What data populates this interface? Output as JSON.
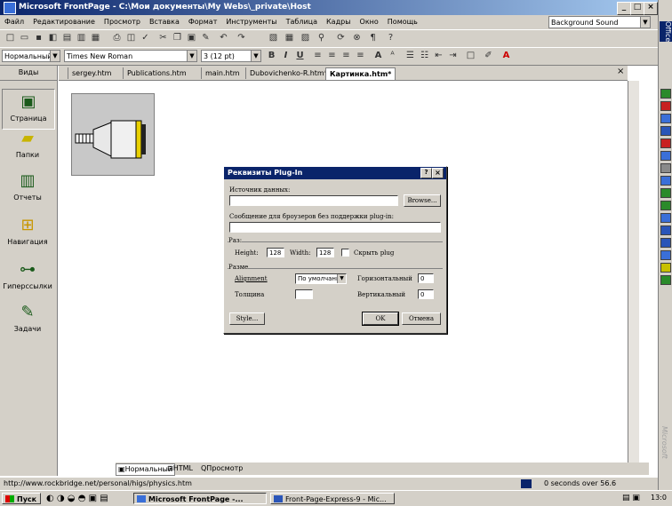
{
  "window": {
    "title": "Microsoft FrontPage - C:\\Мои документы\\My Webs\\_private\\Host",
    "minimize": "_",
    "maximize": "□",
    "close": "×"
  },
  "menu": {
    "items": [
      "Файл",
      "Редактирование",
      "Просмотр",
      "Вставка",
      "Формат",
      "Инструменты",
      "Таблица",
      "Кадры",
      "Окно",
      "Помощь"
    ],
    "background_sound": "Background Sound"
  },
  "format_toolbar": {
    "style": "Нормальный",
    "font": "Times New Roman",
    "size": "3 (12 pt)",
    "bold": "B",
    "italic": "I",
    "underline": "U"
  },
  "views": {
    "header": "Виды",
    "items": [
      "Страница",
      "Папки",
      "Отчеты",
      "Навигация",
      "Гиперссылки",
      "Задачи"
    ]
  },
  "tabs": [
    "sergey.htm",
    "Publications.htm",
    "main.htm",
    "Dubovichenko-R.htm*",
    "Картинка.htm*"
  ],
  "dialog": {
    "title": "Реквизиты Plug-In",
    "help": "?",
    "close": "×",
    "source_label": "Источник данных:",
    "browse": "Browse...",
    "message_label": "Сообщение для броузеров без поддержки plug-in:",
    "size_group": "Раз:",
    "height_label": "Height:",
    "height_value": "128",
    "width_label": "Width:",
    "width_value": "128",
    "hide_label": "Скрыть plug",
    "layout_group": "Разме",
    "alignment_label": "Alignment",
    "alignment_value": "По умолчани",
    "horizontal_label": "Горизонтальный",
    "horizontal_value": "0",
    "thickness_label": "Толщина",
    "vertical_label": "Вертикальный",
    "vertical_value": "0",
    "style_btn": "Style...",
    "ok": "OK",
    "cancel": "Отмена"
  },
  "view_tabs": [
    "Нормальный",
    "HTML",
    "Просмотр"
  ],
  "status": {
    "url": "http://www.rockbridge.net/personal/higs/physics.htm",
    "timing": "0 seconds over 56.6"
  },
  "taskbar": {
    "start": "Пуск",
    "tasks": [
      "Microsoft FrontPage -...",
      "Front-Page-Express-9 - Mic..."
    ],
    "clock": "13:0"
  },
  "office_bar": {
    "label": "Office"
  },
  "watermark": "Microsoft"
}
